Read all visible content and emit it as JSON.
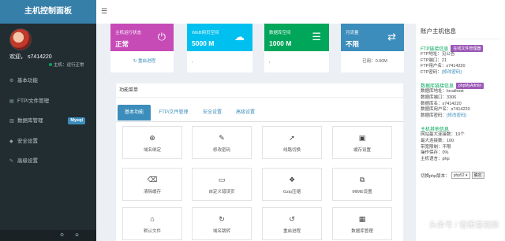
{
  "brand": "主机控制面板",
  "user": {
    "welcome": "欢迎，  s7414220",
    "status": "主机：运行正常"
  },
  "sidebar": {
    "items": [
      {
        "label": "基本功能",
        "icon": "gear-icon",
        "glyph": "⚙"
      },
      {
        "label": "FTP/文件管理",
        "icon": "folder-icon",
        "glyph": "▤"
      },
      {
        "label": "数据库管理",
        "icon": "database-icon",
        "glyph": "▥",
        "badge": "Mysql"
      },
      {
        "label": "安全设置",
        "icon": "shield-icon",
        "glyph": "◆"
      },
      {
        "label": "高级设置",
        "icon": "edit-icon",
        "glyph": "✎"
      }
    ],
    "footer": "⚙ ⊕"
  },
  "topbar": {
    "menu_glyph": "☰"
  },
  "cards": [
    {
      "label": "主机运行状态",
      "value": "正常",
      "glyph": "⏻",
      "footer": "↻  重启进程",
      "color": "#dd4bcf"
    },
    {
      "label": "WEB网页空间",
      "value": "5000 M",
      "glyph": "☁",
      "footer": ",",
      "color": "#00c0ef"
    },
    {
      "label": "数据库空间",
      "value": "1000 M",
      "glyph": "☰",
      "footer": ",",
      "color": "#00a65a"
    },
    {
      "label": "月流量",
      "value": "不限",
      "glyph": "⇄",
      "footer": "已用：0.00M",
      "color": "#3c8dbc"
    }
  ],
  "function_menu": {
    "title": "功能菜单",
    "tabs": [
      "基本功能",
      "FTP/文件管理",
      "安全设置",
      "高级设置"
    ],
    "tiles": [
      {
        "label": "域名绑定",
        "glyph": "⊕",
        "icon": "globe-icon"
      },
      {
        "label": "修改密码",
        "glyph": "✎",
        "icon": "pencil-icon"
      },
      {
        "label": "线路切换",
        "glyph": "➚",
        "icon": "rocket-icon"
      },
      {
        "label": "缓存设置",
        "glyph": "▣",
        "icon": "save-icon"
      },
      {
        "label": "清除缓存",
        "glyph": "⌫",
        "icon": "eraser-icon"
      },
      {
        "label": "自定义错误页",
        "glyph": "▭",
        "icon": "file-icon"
      },
      {
        "label": "Gzip压缩",
        "glyph": "❖",
        "icon": "gzip-icon"
      },
      {
        "label": "MIME设置",
        "glyph": "⧉",
        "icon": "dropbox-icon"
      },
      {
        "label": "默认文件",
        "glyph": "⌂",
        "icon": "home-icon"
      },
      {
        "label": "域名跳转",
        "glyph": "↻",
        "icon": "refresh-icon"
      },
      {
        "label": "重启进程",
        "glyph": "↺",
        "icon": "restart-icon"
      },
      {
        "label": "数据库管理",
        "glyph": "▦",
        "icon": "table-icon"
      }
    ]
  },
  "info": {
    "title": "账户主机信息",
    "ftp_title": "FTP链接信息",
    "ftp_button": "在线文件管理器",
    "ftp_lines": [
      "FTP地址：见公告",
      "FTP端口：21",
      "FTP用户名：s7414220"
    ],
    "ftp_pw_label": "FTP密码：",
    "ftp_pw_link": "[修改密码]",
    "db_title": "数据库链接信息",
    "db_button": "phpMyAdmin",
    "db_lines": [
      "数据库地址：localhost",
      "数据库端口：3306",
      "数据库名：s7414220",
      "数据库用户名：s7414220"
    ],
    "db_pw_label": "数据库密码：",
    "db_pw_link": "[修改密码]",
    "host_title": "主机其他信息",
    "host_lines": [
      "网站最大连接数：10个",
      "最大连接数：100",
      "带宽限制：不限",
      "操作保存：0%",
      "主机语言：php"
    ],
    "version_label": "切换php版本：",
    "version_value": "php52",
    "version_button": "确定",
    "colors": {
      "green": "#00a65a",
      "purple": "#9b59b6",
      "blue": "#3c8dbc"
    }
  },
  "watermark": "头条号 / 香蕉看视频"
}
